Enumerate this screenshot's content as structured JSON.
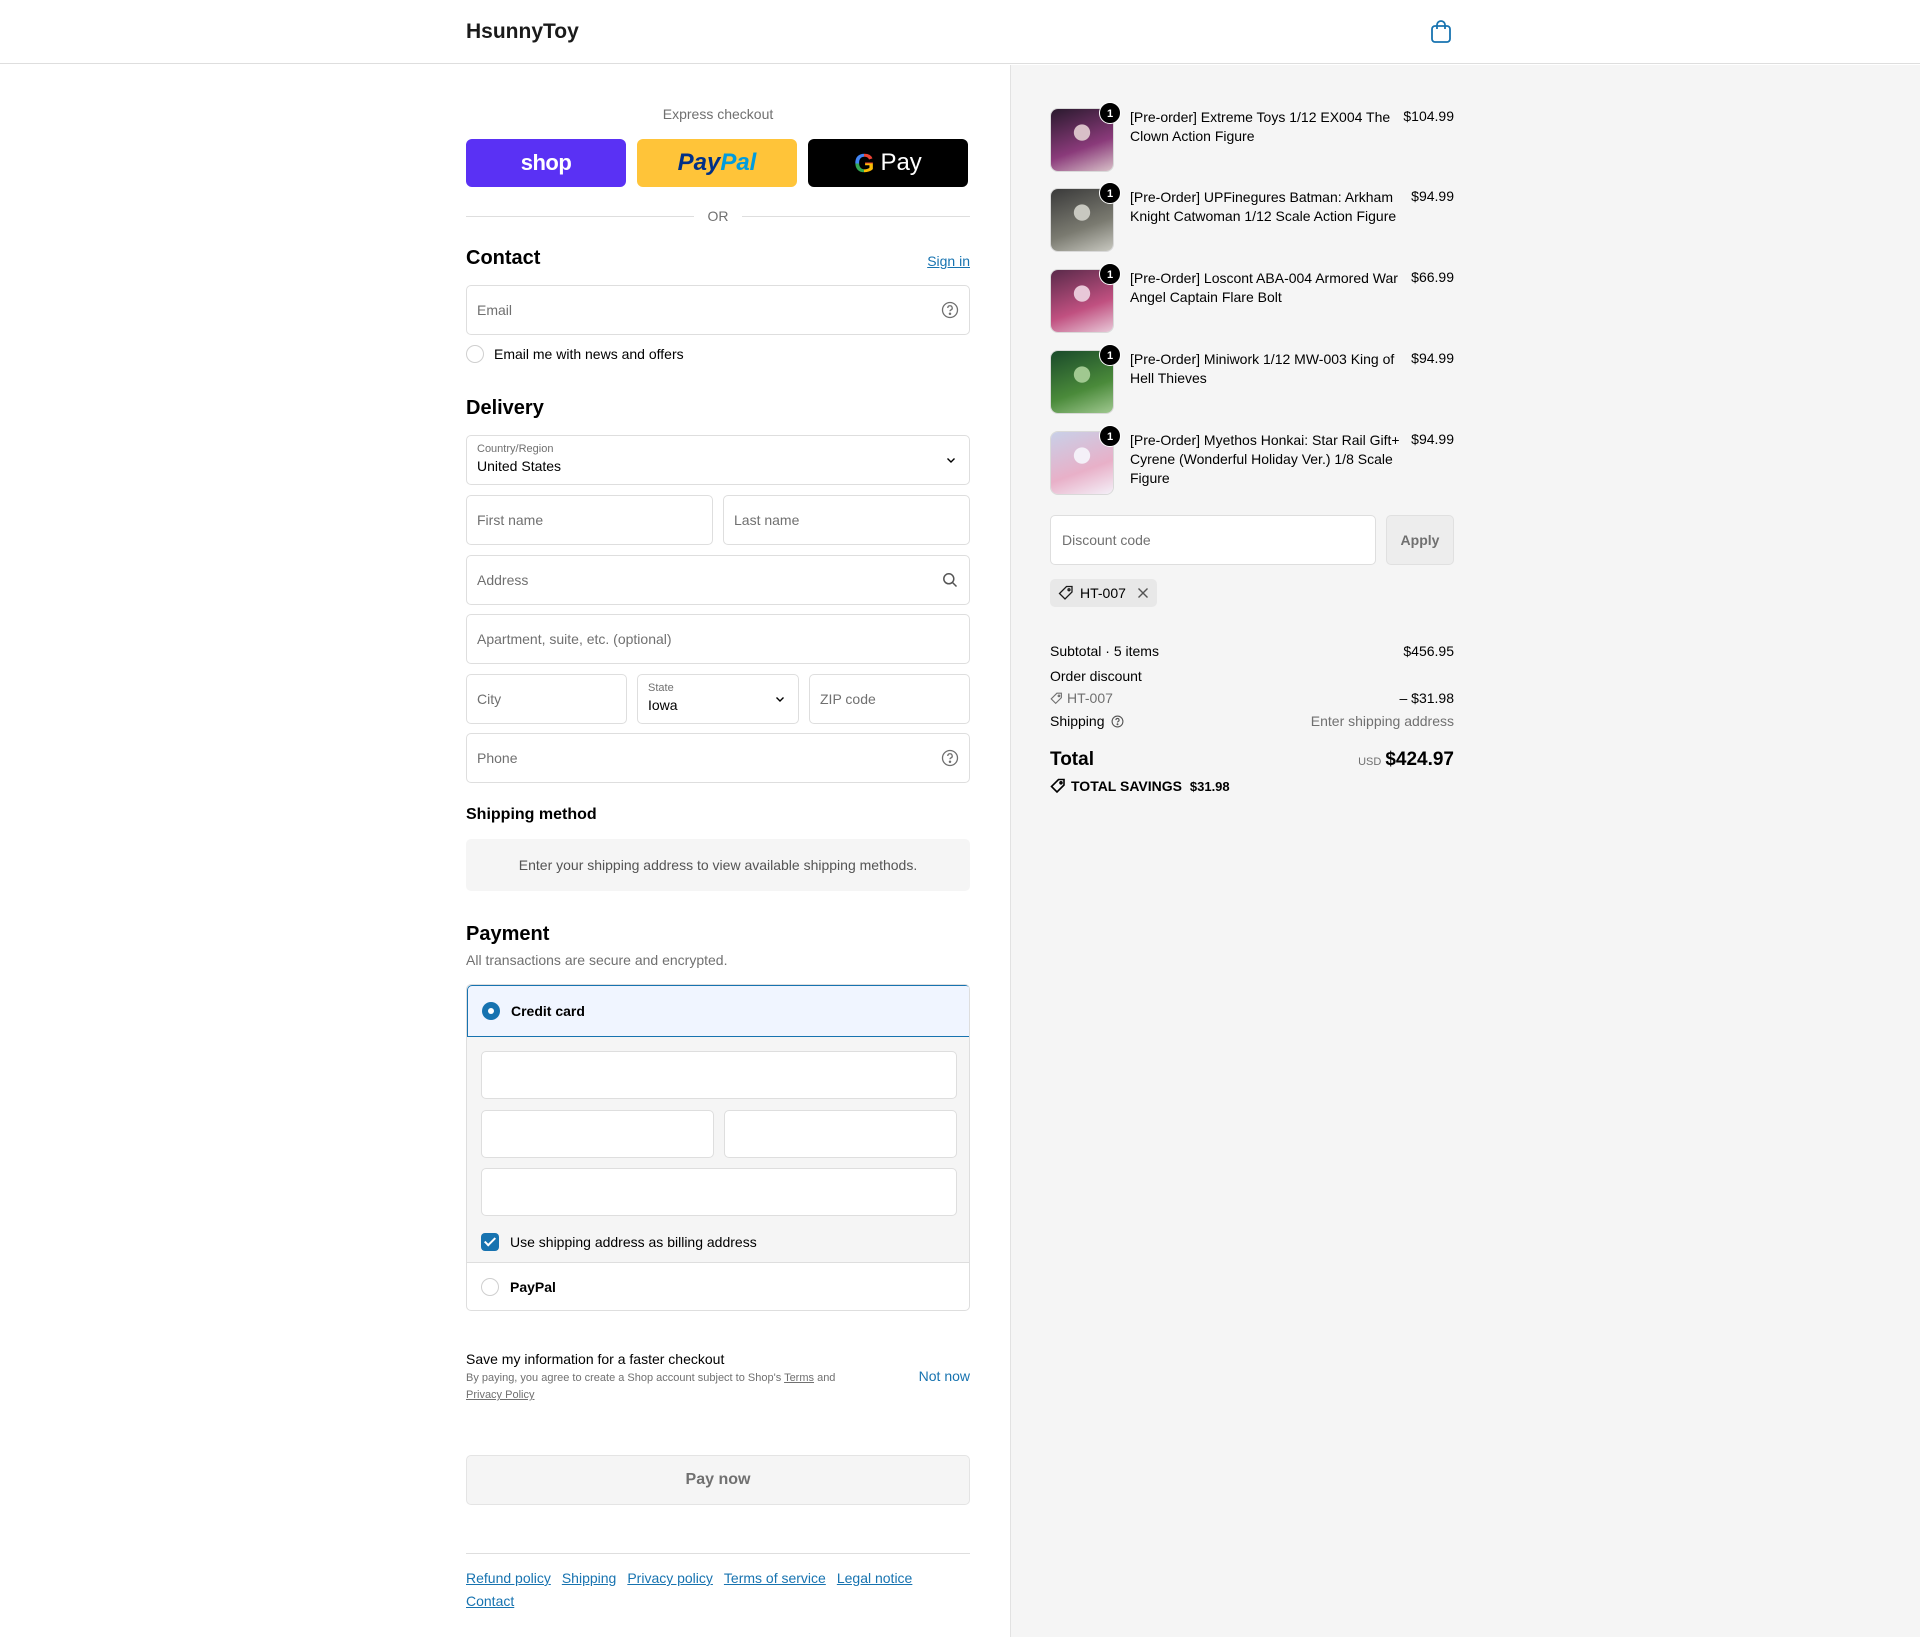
{
  "header": {
    "logo": "HsunnyToy",
    "cart_icon": "shopping-bag-icon"
  },
  "express": {
    "title": "Express checkout",
    "shop_label": "shop",
    "paypal_part1": "Pay",
    "paypal_part2": "Pal",
    "gpay_g": "G",
    "gpay_label": "Pay",
    "or_label": "OR"
  },
  "contact": {
    "heading": "Contact",
    "sign_in": "Sign in",
    "email_placeholder": "Email",
    "news_label": "Email me with news and offers"
  },
  "delivery": {
    "heading": "Delivery",
    "country_label": "Country/Region",
    "country_value": "United States",
    "first_name_ph": "First name",
    "last_name_ph": "Last name",
    "address_ph": "Address",
    "apartment_ph": "Apartment, suite, etc. (optional)",
    "city_ph": "City",
    "state_label": "State",
    "state_value": "Iowa",
    "zip_ph": "ZIP code",
    "phone_ph": "Phone"
  },
  "shipping_method": {
    "heading": "Shipping method",
    "message": "Enter your shipping address to view available shipping methods."
  },
  "payment": {
    "heading": "Payment",
    "subtitle": "All transactions are secure and encrypted.",
    "credit_card_label": "Credit card",
    "billing_label": "Use shipping address as billing address",
    "paypal_label": "PayPal"
  },
  "save_info": {
    "title": "Save my information for a faster checkout",
    "desc_prefix": "By paying, you agree to create a Shop account subject to Shop's ",
    "terms": "Terms",
    "and": " and ",
    "privacy": "Privacy Policy",
    "not_now": "Not now"
  },
  "pay_button": "Pay now",
  "footer_links": [
    "Refund policy",
    "Shipping",
    "Privacy policy",
    "Terms of service",
    "Legal notice",
    "Contact"
  ],
  "cart": {
    "items": [
      {
        "name": "[Pre-order] Extreme Toys 1/12 EX004 The Clown Action Figure",
        "price": "$104.99",
        "qty": "1",
        "colors": [
          "#2a1a2e",
          "#8a3a7a",
          "#d8c0c8"
        ]
      },
      {
        "name": "[Pre-Order] UPFinegures Batman: Arkham Knight Catwoman 1/12 Scale Action Figure",
        "price": "$94.99",
        "qty": "1",
        "colors": [
          "#3a3a3a",
          "#7a7a70",
          "#c8c8c0"
        ]
      },
      {
        "name": "[Pre-Order] Loscont ABA-004 Armored War Angel Captain Flare Bolt",
        "price": "$66.99",
        "qty": "1",
        "colors": [
          "#5a2a4a",
          "#c05080",
          "#e8c8d8"
        ]
      },
      {
        "name": "[Pre-Order] Miniwork 1/12 MW-003 King of Hell Thieves",
        "price": "$94.99",
        "qty": "1",
        "colors": [
          "#1a4a2a",
          "#4a8a3a",
          "#a0c890"
        ]
      },
      {
        "name": "[Pre-Order] Myethos Honkai: Star Rail Gift+ Cyrene (Wonderful Holiday Ver.) 1/8 Scale Figure",
        "price": "$94.99",
        "qty": "1",
        "colors": [
          "#c8d0e8",
          "#e8b0c8",
          "#f4f0f8"
        ]
      }
    ],
    "discount_placeholder": "Discount code",
    "apply_label": "Apply",
    "applied_code": "HT-007"
  },
  "summary": {
    "subtotal_label": "Subtotal · 5 items",
    "subtotal_value": "$456.95",
    "order_discount_label": "Order discount",
    "discount_code": "HT-007",
    "discount_value": "– $31.98",
    "shipping_label": "Shipping",
    "shipping_value": "Enter shipping address",
    "total_label": "Total",
    "currency": "USD",
    "total_value": "$424.97",
    "savings_label": "TOTAL SAVINGS",
    "savings_value": "$31.98"
  },
  "colors": {
    "accent": "#1773b0",
    "shop_purple": "#5a31f4",
    "paypal_yellow": "#ffc439"
  }
}
